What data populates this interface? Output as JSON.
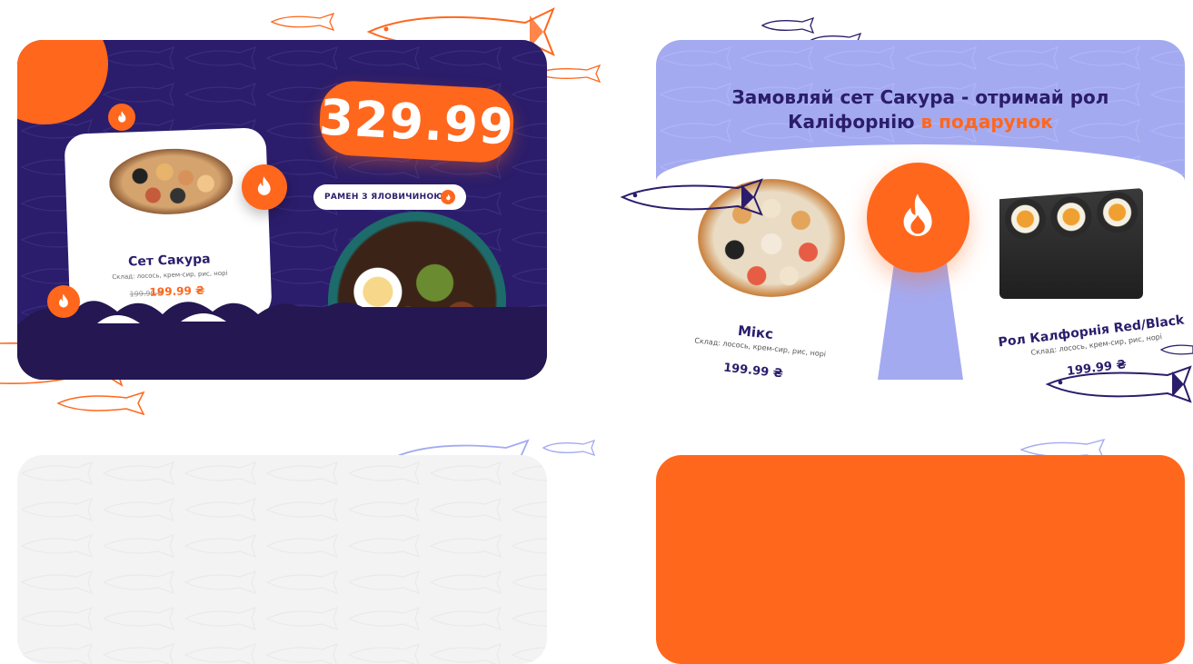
{
  "colors": {
    "orange": "#ff671d",
    "navy": "#2b1d6b",
    "lavender": "#a4aaf0",
    "light_gray": "#f3f3f4"
  },
  "banner_1": {
    "price": "329.99",
    "ramen_label": "РАМЕН З ЯЛОВИЧИНОЮ",
    "product": {
      "name": "Сет Сакура",
      "description": "Склад: лосось, крем-сир, рис, норі",
      "old_price": "199.99 ₴",
      "new_price": "199.99 ₴"
    },
    "icons": [
      "fire-icon",
      "fish-icon",
      "wave-decoration"
    ]
  },
  "banner_2": {
    "title_line1": "Замовляй сет Сакура - отримай рол",
    "title_line2_plain": "Каліфорнію ",
    "title_line2_accent": "в подарунок",
    "product_left": {
      "name": "Мікс",
      "description": "Склад: лосось, крем-сир, рис, норі",
      "price": "199.99 ₴"
    },
    "product_right": {
      "name": "Рол Калфорнія Red/Black",
      "description": "Склад: лосось, крем-сир, рис, норі",
      "price": "199.99 ₴"
    }
  }
}
